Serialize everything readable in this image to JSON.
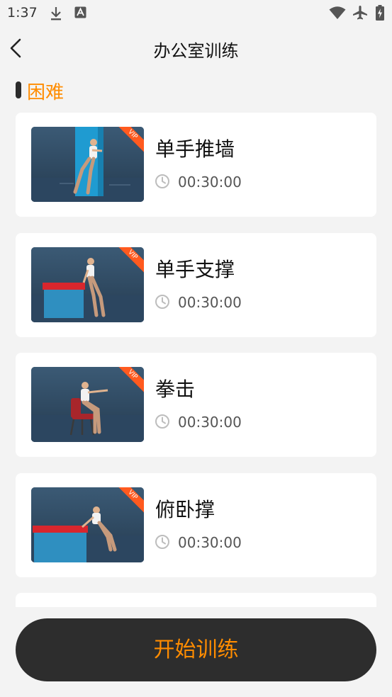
{
  "status_bar": {
    "time": "1:37",
    "icons": [
      "download-icon",
      "text-icon",
      "wifi-icon",
      "airplane-icon",
      "battery-icon"
    ]
  },
  "header": {
    "title": "办公室训练",
    "back_icon": "chevron-left-icon"
  },
  "section": {
    "title": "困难"
  },
  "exercises": [
    {
      "name": "单手推墙",
      "duration": "00:30:00",
      "badge": "VIP"
    },
    {
      "name": "单手支撑",
      "duration": "00:30:00",
      "badge": "VIP"
    },
    {
      "name": "拳击",
      "duration": "00:30:00",
      "badge": "VIP"
    },
    {
      "name": "俯卧撑",
      "duration": "00:30:00",
      "badge": "VIP"
    }
  ],
  "start_button": {
    "label": "开始训练"
  },
  "colors": {
    "accent": "#ff8c00",
    "button_bg": "#2d2d2d",
    "background": "#f3f3f3",
    "vip": "#ff5a1f"
  }
}
